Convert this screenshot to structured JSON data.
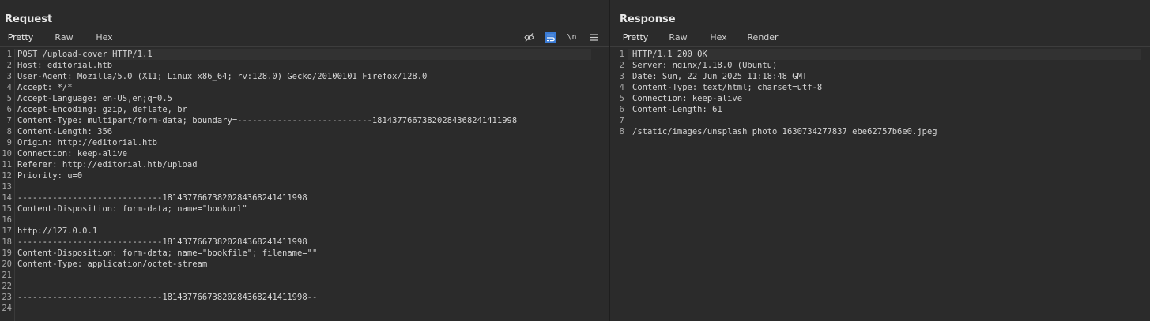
{
  "request": {
    "title": "Request",
    "tabs": [
      "Pretty",
      "Raw",
      "Hex"
    ],
    "active_tab": "Pretty",
    "tools": [
      "hide-nonprintable-icon",
      "wrap-lines-icon",
      "newline-toggle-icon",
      "menu-icon"
    ],
    "newline_label": "\\n",
    "lines": [
      "POST /upload-cover HTTP/1.1",
      "Host: editorial.htb",
      "User-Agent: Mozilla/5.0 (X11; Linux x86_64; rv:128.0) Gecko/20100101 Firefox/128.0",
      "Accept: */*",
      "Accept-Language: en-US,en;q=0.5",
      "Accept-Encoding: gzip, deflate, br",
      "Content-Type: multipart/form-data; boundary=---------------------------181437766738202843682414119​98",
      "Content-Length: 356",
      "Origin: http://editorial.htb",
      "Connection: keep-alive",
      "Referer: http://editorial.htb/upload",
      "Priority: u=0",
      "",
      "-----------------------------181437766738202843682414119​98",
      "Content-Disposition: form-data; name=\"bookurl\"",
      "",
      "http://127.0.0.1",
      "-----------------------------181437766738202843682414119​98",
      "Content-Disposition: form-data; name=\"bookfile\"; filename=\"\"",
      "Content-Type: application/octet-stream",
      "",
      "",
      "-----------------------------181437766738202843682414119​98--",
      ""
    ]
  },
  "response": {
    "title": "Response",
    "tabs": [
      "Pretty",
      "Raw",
      "Hex",
      "Render"
    ],
    "active_tab": "Pretty",
    "lines": [
      "HTTP/1.1 200 OK",
      "Server: nginx/1.18.0 (Ubuntu)",
      "Date: Sun, 22 Jun 2025 11:18:48 GMT",
      "Content-Type: text/html; charset=utf-8",
      "Connection: keep-alive",
      "Content-Length: 61",
      "",
      "/static/images/unsplash_photo_1630734277837_ebe62757b6e0.jpeg"
    ]
  },
  "colors": {
    "background": "#2b2b2b",
    "active_tab_underline": "#e0793a",
    "toggle_on": "#3a7bd5"
  }
}
